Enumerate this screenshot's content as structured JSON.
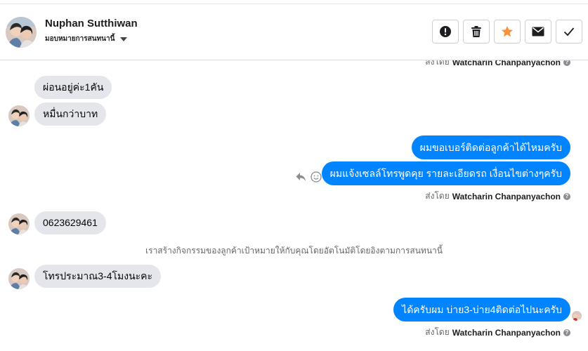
{
  "header": {
    "contact_name": "Nuphan Sutthiwan",
    "assign_label": "มอบหมายการสนทนานี้",
    "actions": [
      {
        "name": "spam-button",
        "icon": "alert-icon"
      },
      {
        "name": "delete-button",
        "icon": "trash-icon"
      },
      {
        "name": "star-button",
        "icon": "star-icon",
        "color": "#f7923a"
      },
      {
        "name": "unread-button",
        "icon": "envelope-icon"
      },
      {
        "name": "done-button",
        "icon": "check-icon"
      }
    ]
  },
  "chat": {
    "sent_by_prefix": "ส่งโดย",
    "agent_name": "Watcharin Chanpanyachon",
    "messages": [
      {
        "text": "ผ่อนอยู่ค่ะ1คัน"
      },
      {
        "text": "หมื่นกว่าบาท"
      },
      {
        "text": "ผมขอเบอร์ติดต่อลูกค้าได้ไหมครับ"
      },
      {
        "text": "ผมแจ้งเซลล์โทรพูดคุย รายละเอียดรถ เงื่อนไขต่างๆครับ"
      },
      {
        "text": "0623629461"
      },
      {
        "text": "โทรประมาณ3-4โมงนะคะ"
      },
      {
        "text": "ได้ครับผม บ่าย3-บ่าย4ติดต่อไปนะครับ"
      }
    ],
    "system_note": "เราสร้างกิจกรรมของลูกค้าเป้าหมายให้กับคุณโดยอัตโนมัติโดยอิงตามการสนทนานี้"
  },
  "colors": {
    "outgoing": "#0084ff",
    "incoming": "#e4e6eb",
    "star": "#f7923a"
  }
}
